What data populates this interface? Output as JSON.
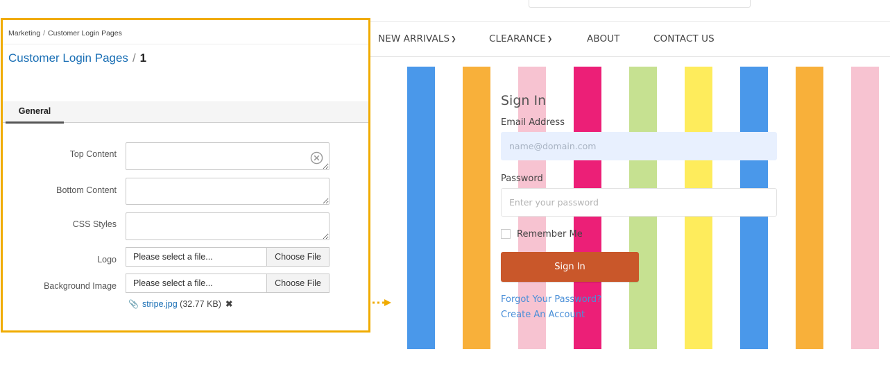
{
  "store": {
    "nav": [
      {
        "label": "NEW ARRIVALS",
        "has_dropdown": true
      },
      {
        "label": "CLEARANCE",
        "has_dropdown": true
      },
      {
        "label": "ABOUT",
        "has_dropdown": false
      },
      {
        "label": "CONTACT US",
        "has_dropdown": false
      }
    ],
    "stripe_colors": [
      "#4a98ea",
      "#f8b03a",
      "#f7c3d1",
      "#ec1f77",
      "#c6e191",
      "#feec5c",
      "#4a98ea",
      "#f8b03a",
      "#f7c3d1"
    ],
    "signin": {
      "title": "Sign In",
      "email_label": "Email Address",
      "email_placeholder": "name@domain.com",
      "password_label": "Password",
      "password_placeholder": "Enter your password",
      "remember_label": "Remember Me",
      "button_label": "Sign In",
      "button_color": "#c9572a",
      "forgot_link": "Forgot Your Password?",
      "create_link": "Create An Account"
    }
  },
  "admin": {
    "breadcrumb": [
      "Marketing",
      "Customer Login Pages"
    ],
    "title": "Customer Login Pages",
    "title_separator": "/",
    "record_id": "1",
    "tabs": [
      "General"
    ],
    "fields": {
      "top_content": "Top Content",
      "bottom_content": "Bottom Content",
      "css_styles": "CSS Styles",
      "logo": "Logo",
      "background_image": "Background Image"
    },
    "file_placeholder": "Please select a file...",
    "choose_file": "Choose File",
    "attachment": {
      "name": "stripe.jpg",
      "size": "(32.77 KB)"
    },
    "highlight_color": "#f0ab00",
    "link_color": "#1a6fb5"
  }
}
